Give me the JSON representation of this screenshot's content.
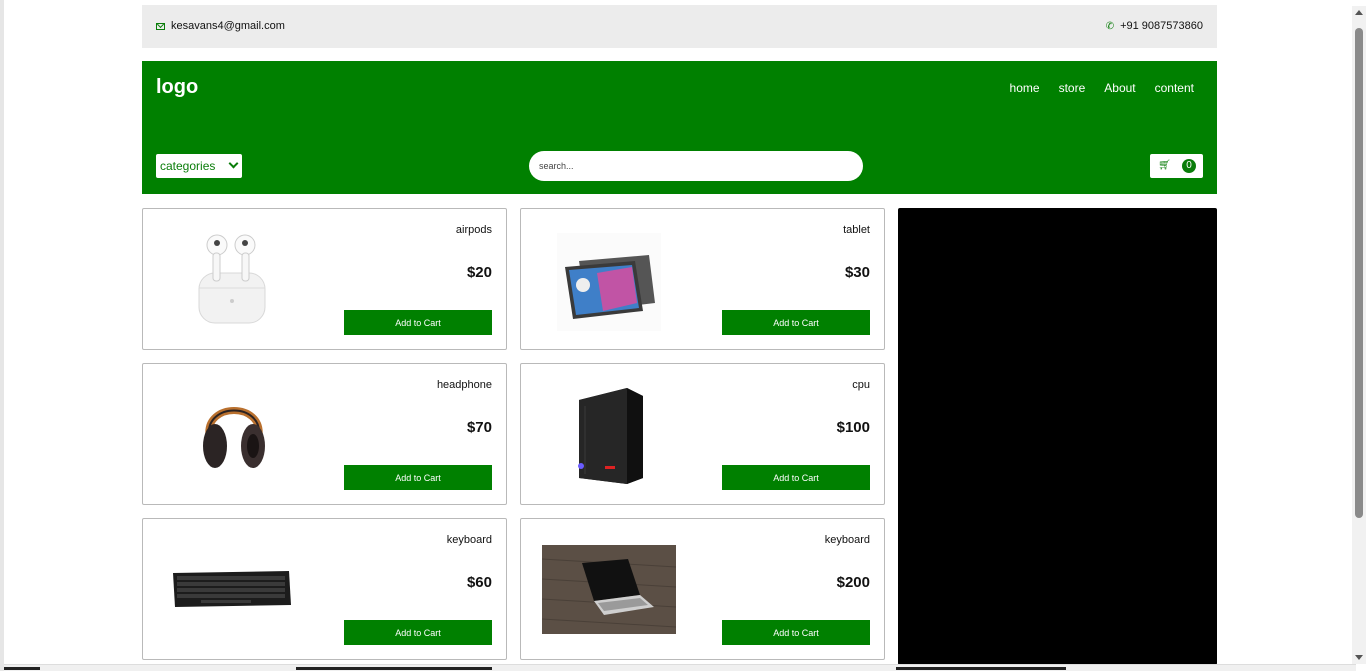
{
  "topbar": {
    "email": "kesavans4@gmail.com",
    "phone": "+91 9087573860",
    "email_icon": "mail-icon",
    "phone_icon": "phone-icon"
  },
  "header": {
    "logo": "logo",
    "nav": [
      "home",
      "store",
      "About",
      "content"
    ],
    "categories_label": "categories",
    "search_placeholder": "search...",
    "cart_count": "0",
    "cart_icon": "cart-icon",
    "brand_color": "#008000"
  },
  "products": [
    {
      "name": "airpods",
      "price": "$20",
      "button": "Add to Cart",
      "image": "airpods-image"
    },
    {
      "name": "tablet",
      "price": "$30",
      "button": "Add to Cart",
      "image": "tablet-image"
    },
    {
      "name": "headphone",
      "price": "$70",
      "button": "Add to Cart",
      "image": "headphone-image"
    },
    {
      "name": "cpu",
      "price": "$100",
      "button": "Add to Cart",
      "image": "cpu-image"
    },
    {
      "name": "keyboard",
      "price": "$60",
      "button": "Add to Cart",
      "image": "keyboard-image"
    },
    {
      "name": "keyboard",
      "price": "$200",
      "button": "Add to Cart",
      "image": "laptop-image"
    }
  ]
}
